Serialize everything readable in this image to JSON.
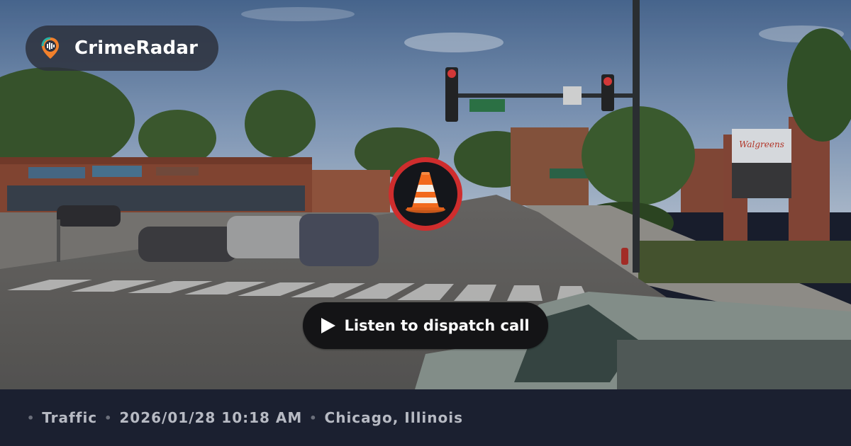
{
  "brand": {
    "name": "CrimeRadar",
    "logo_icon": "radar-pin-icon"
  },
  "incident_icon": "traffic-cone-icon",
  "audio": {
    "play_icon": "play-icon",
    "label": "Listen to dispatch call"
  },
  "info_bar": {
    "separator": "•",
    "category": "Traffic",
    "datetime": "2026/01/28 10:18 AM",
    "location": "Chicago, Illinois"
  },
  "street_scene": {
    "sign_text": "Walgreens"
  },
  "colors": {
    "badge_ring": "#cf2d2d",
    "cone_orange": "#f26a1d",
    "logo_orange": "#f2812c",
    "logo_teal": "#27b3a6",
    "info_bar_bg": "#1b2030"
  }
}
